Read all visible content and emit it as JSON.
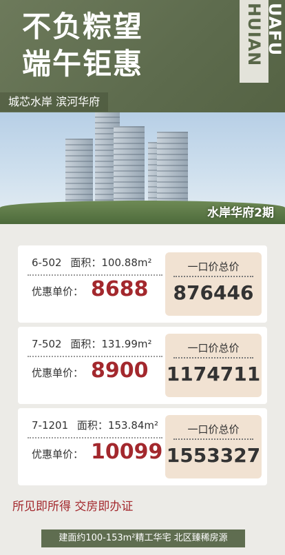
{
  "hero": {
    "headline_line1": "不负粽望",
    "headline_line2": "端午钜惠",
    "vertical_left": "HUIAN",
    "vertical_right": "UAFU",
    "tag": "城芯水岸 滨河华府"
  },
  "photo": {
    "caption": "水岸华府2期"
  },
  "cards": [
    {
      "unit": "6-502",
      "area_label": "面积：100.88m²",
      "price_label": "优惠单价：",
      "unit_price": "8688",
      "total_label": "一口价总价",
      "total": "876446"
    },
    {
      "unit": "7-502",
      "area_label": "面积：131.99m²",
      "price_label": "优惠单价：",
      "unit_price": "8900",
      "total_label": "一口价总价",
      "total": "1174711"
    },
    {
      "unit": "7-1201",
      "area_label": "面积：153.84m²",
      "price_label": "优惠单价：",
      "unit_price": "10099",
      "total_label": "一口价总价",
      "total": "1553327"
    }
  ],
  "slogan": "所见即所得  交房即办证",
  "footer": "建面约100-153m²精工华宅  北区臻稀房源",
  "colors": {
    "olive": "#5f6d50",
    "accent_red": "#a3282d",
    "price_box": "#f1e2d2"
  }
}
